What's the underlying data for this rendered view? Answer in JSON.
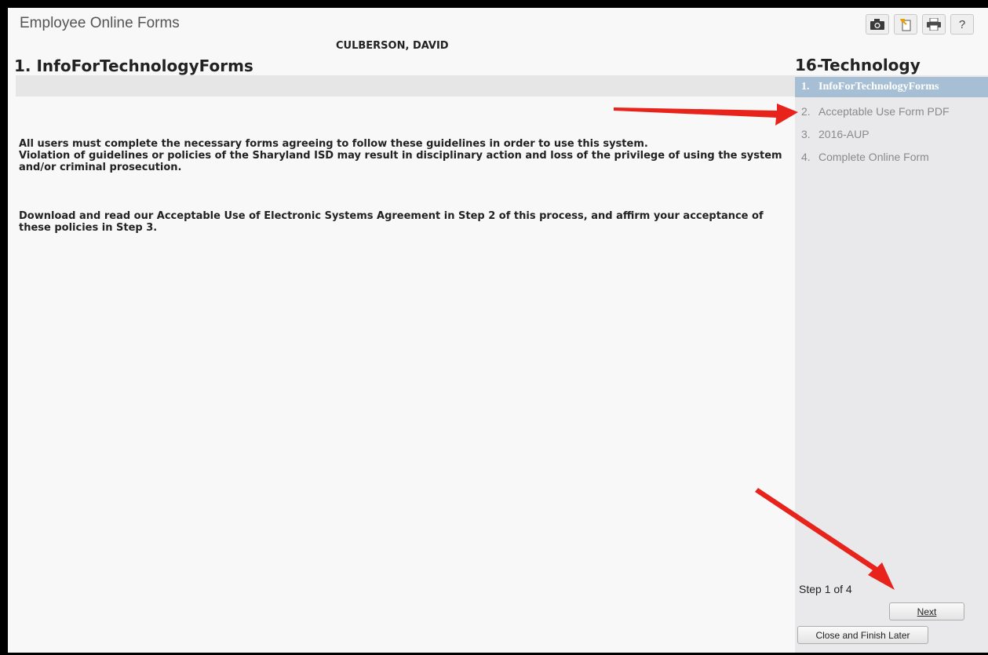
{
  "app": {
    "title": "Employee Online Forms"
  },
  "toolbar": {
    "icons": [
      "camera-icon",
      "new-window-icon",
      "print-icon",
      "help-icon"
    ],
    "help_label": "?"
  },
  "user": {
    "name": "CULBERSON, DAVID"
  },
  "page": {
    "heading": "1. InfoForTechnologyForms"
  },
  "content": {
    "paragraph1_line1": "All users must complete the necessary forms agreeing to follow these guidelines in order to use this system.",
    "paragraph1_line2": "Violation of guidelines or policies of the Sharyland ISD may result in disciplinary action and loss of the privilege of using the system and/or criminal prosecution.",
    "paragraph2": "Download and read our Acceptable Use of Electronic Systems Agreement in Step 2 of this process, and affirm your acceptance of these policies in Step 3."
  },
  "sidebar": {
    "heading": "16-Technology",
    "steps": [
      {
        "num": "1.",
        "label": "InfoForTechnologyForms",
        "active": true
      },
      {
        "num": "2.",
        "label": "Acceptable Use Form PDF",
        "active": false
      },
      {
        "num": "3.",
        "label": "2016-AUP",
        "active": false
      },
      {
        "num": "4.",
        "label": "Complete Online Form",
        "active": false
      }
    ],
    "step_indicator": "Step 1 of 4"
  },
  "buttons": {
    "next_label": "Next",
    "close_label": "Close and Finish Later"
  },
  "colors": {
    "annotation_arrow": "#e8231b",
    "active_step": "#a6bfd5"
  }
}
